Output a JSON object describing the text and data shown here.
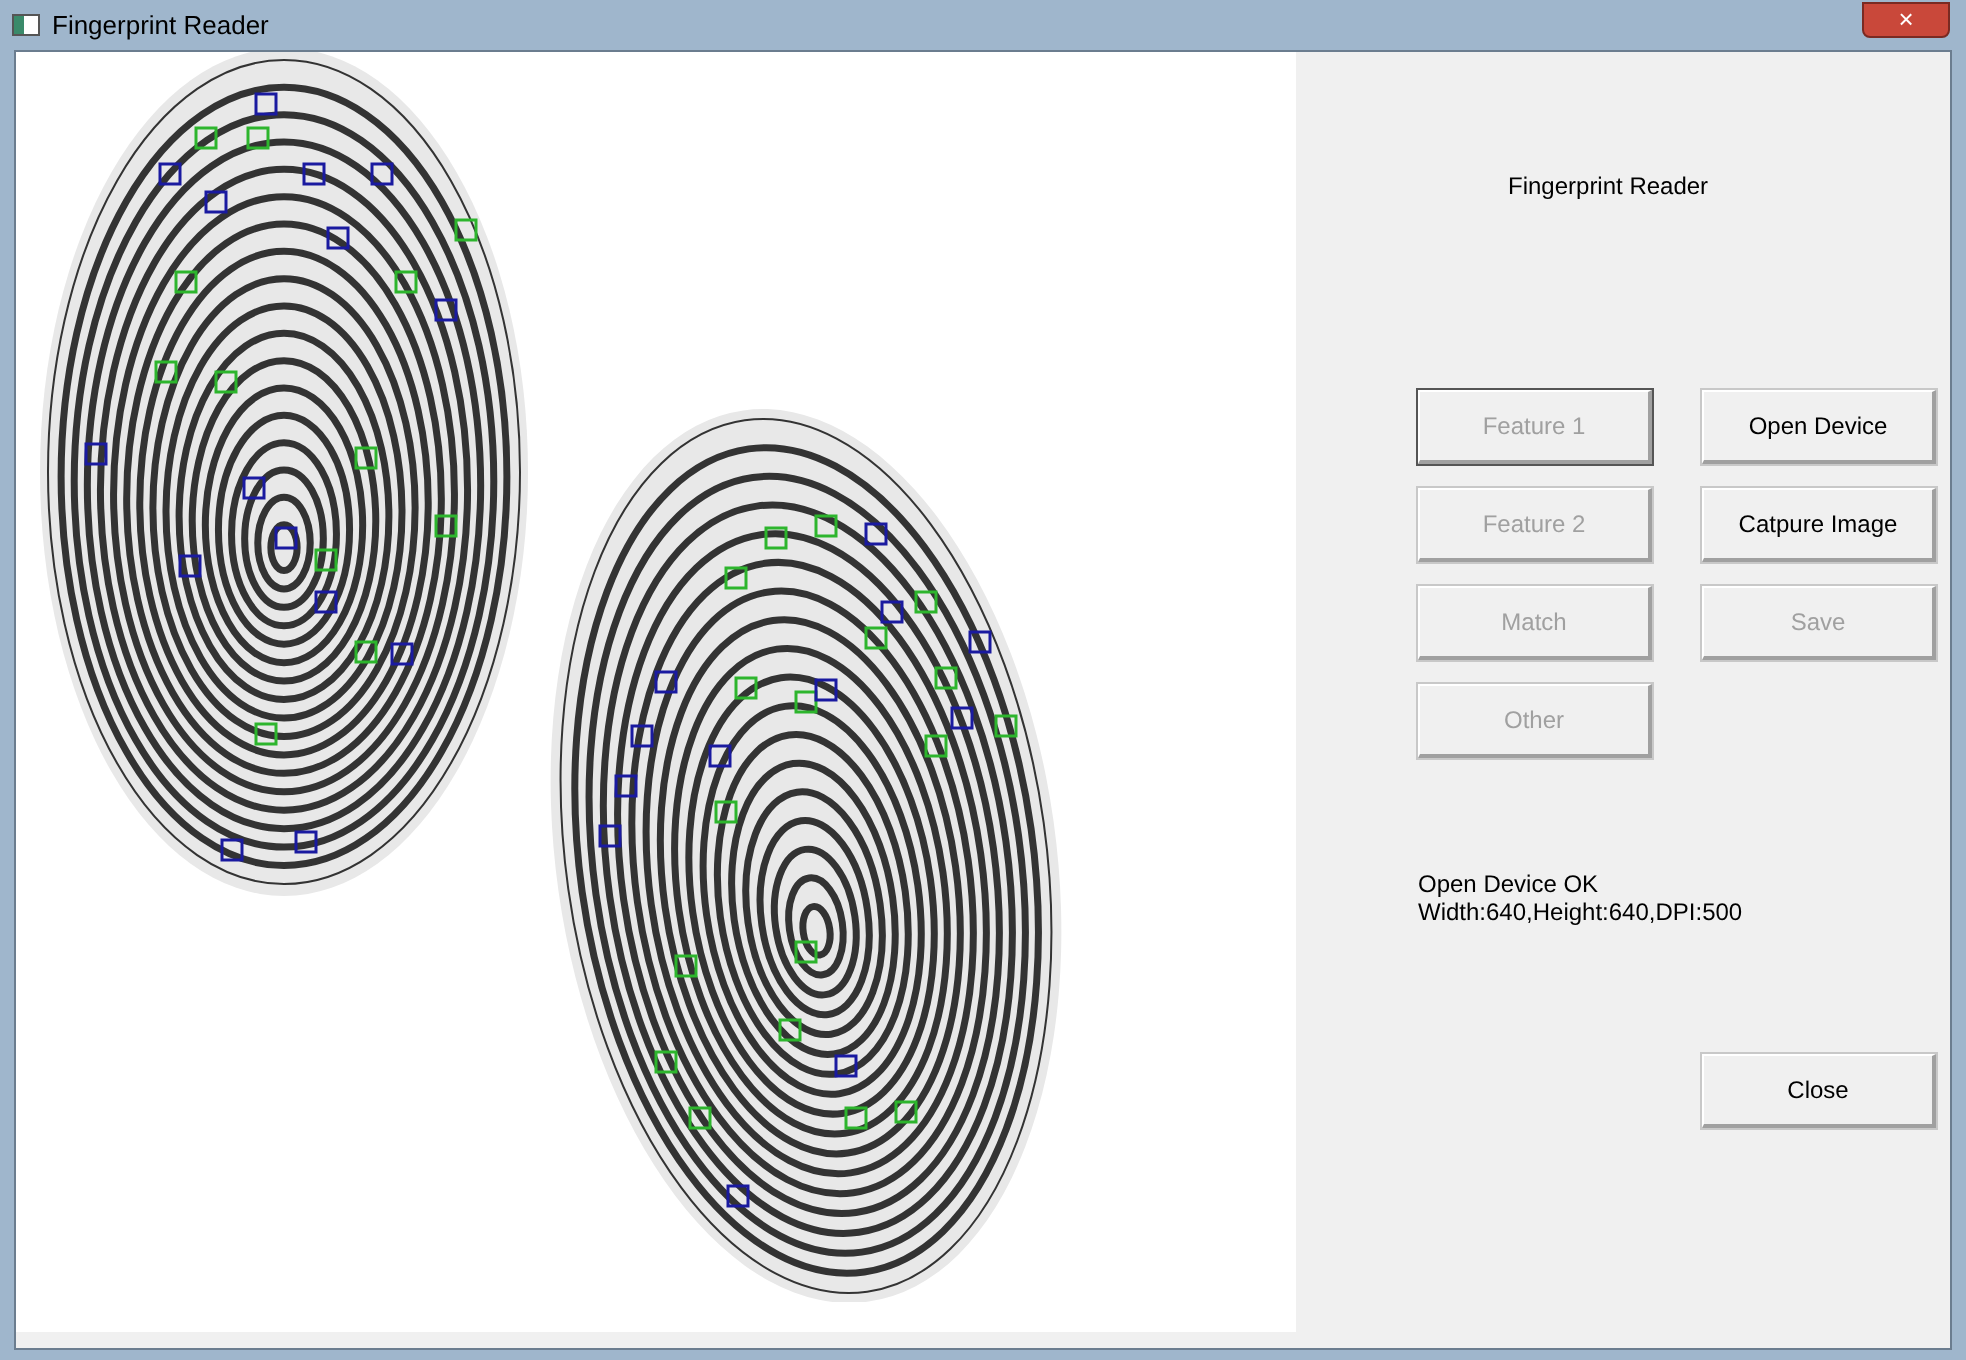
{
  "window": {
    "title": "Fingerprint Reader",
    "close_glyph": "×"
  },
  "panel_title": "Fingerprint Reader",
  "left_buttons": [
    {
      "label": "Feature 1",
      "disabled": true,
      "focused": true
    },
    {
      "label": "Feature 2",
      "disabled": true,
      "focused": false
    },
    {
      "label": "Match",
      "disabled": true,
      "focused": false
    },
    {
      "label": "Other",
      "disabled": true,
      "focused": false
    }
  ],
  "right_buttons": [
    {
      "label": "Open Device",
      "disabled": false,
      "focused": false
    },
    {
      "label": "Catpure Image",
      "disabled": false,
      "focused": false
    },
    {
      "label": "Save",
      "disabled": true,
      "focused": false
    }
  ],
  "status_lines": [
    "Open Device OK",
    "Width:640,Height:640,DPI:500"
  ],
  "close_button": {
    "label": "Close",
    "disabled": false,
    "focused": false
  }
}
